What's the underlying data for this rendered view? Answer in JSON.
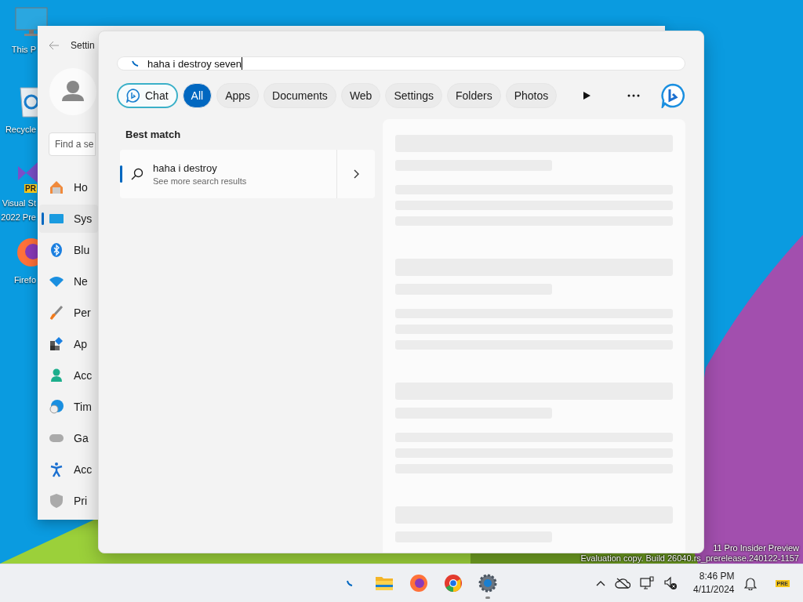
{
  "desktop_icons": [
    {
      "kind": "pc",
      "lines": [
        "This P"
      ]
    },
    {
      "kind": "recycle",
      "lines": [
        "Recycle"
      ]
    },
    {
      "kind": "studio",
      "badge": "PR",
      "lines": [
        "Visual St",
        "2022 Pre"
      ]
    },
    {
      "kind": "firefox",
      "lines": [
        "Firefo"
      ]
    }
  ],
  "settings_window": {
    "title": "Settin",
    "search_placeholder": "Find a se",
    "nav": [
      {
        "kind": "home",
        "label": "Ho",
        "selected": false
      },
      {
        "kind": "system",
        "label": "Sys",
        "selected": true
      },
      {
        "kind": "bluetooth",
        "label": "Blu",
        "selected": false
      },
      {
        "kind": "network",
        "label": "Ne",
        "selected": false
      },
      {
        "kind": "personalization",
        "label": "Per",
        "selected": false
      },
      {
        "kind": "apps",
        "label": "Ap",
        "selected": false
      },
      {
        "kind": "accounts",
        "label": "Acc",
        "selected": false
      },
      {
        "kind": "time",
        "label": "Tim",
        "selected": false
      },
      {
        "kind": "gaming",
        "label": "Ga",
        "selected": false
      },
      {
        "kind": "accessibility",
        "label": "Acc",
        "selected": false
      },
      {
        "kind": "privacy",
        "label": "Pri",
        "selected": false
      }
    ]
  },
  "search_panel": {
    "query": "haha i destroy seven",
    "filters": [
      {
        "kind": "chat",
        "label": "Chat",
        "selected": false
      },
      {
        "kind": "plain",
        "label": "All",
        "selected": true
      },
      {
        "kind": "plain",
        "label": "Apps",
        "selected": false
      },
      {
        "kind": "plain",
        "label": "Documents",
        "selected": false
      },
      {
        "kind": "plain",
        "label": "Web",
        "selected": false
      },
      {
        "kind": "plain",
        "label": "Settings",
        "selected": false
      },
      {
        "kind": "plain",
        "label": "Folders",
        "selected": false
      },
      {
        "kind": "plain",
        "label": "Photos",
        "selected": false
      }
    ],
    "section_title": "Best match",
    "best_match": {
      "title": "haha i destroy",
      "subtitle": "See more search results"
    }
  },
  "watermark": [
    "11 Pro Insider Preview",
    "Evaluation copy. Build 26040.rs_prerelease.240122-1157"
  ],
  "taskbar": {
    "apps": [
      {
        "kind": "search",
        "running": false
      },
      {
        "kind": "explorer",
        "running": false
      },
      {
        "kind": "firefox",
        "running": false
      },
      {
        "kind": "chrome",
        "running": false
      },
      {
        "kind": "settings",
        "running": true
      }
    ],
    "time": "8:46 PM",
    "date": "4/11/2024",
    "badge": "PRE"
  }
}
